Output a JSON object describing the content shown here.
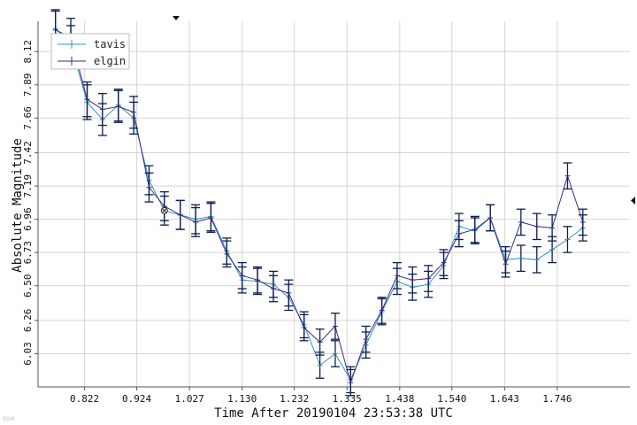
{
  "chart_data": {
    "type": "line",
    "xlabel": "Time After 20190104 23:53:38 UTC",
    "ylabel": "Absolute Magnitude",
    "x_ticks": [
      0.822,
      0.924,
      1.027,
      1.13,
      1.232,
      1.335,
      1.438,
      1.54,
      1.643,
      1.746
    ],
    "x_tick_labels": [
      "0.822",
      "0.924",
      "1.027",
      "1.130",
      "1.232",
      "1.335",
      "1.438",
      "1.540",
      "1.643",
      "1.746"
    ],
    "y_ticks": [
      6.03,
      6.26,
      6.5,
      6.73,
      6.96,
      7.19,
      7.42,
      7.66,
      7.89,
      8.12
    ],
    "y_tick_labels": [
      "6.03",
      "6.26",
      "6.50",
      "6.73",
      "6.96",
      "7.19",
      "7.42",
      "7.66",
      "7.89",
      "8.12"
    ],
    "xlim": [
      0.731,
      1.888
    ],
    "ylim": [
      8.33,
      5.8
    ],
    "y_inverted": true,
    "grid": true,
    "legend_position": "top-left",
    "series": [
      {
        "name": "tavis",
        "color": "#2f97b4",
        "x": [
          0.765,
          0.795,
          0.827,
          0.857,
          0.888,
          0.918,
          0.948,
          0.978,
          1.009,
          1.039,
          1.069,
          1.1,
          1.13,
          1.16,
          1.191,
          1.221,
          1.251,
          1.282,
          1.312,
          1.342,
          1.372,
          1.403,
          1.433,
          1.463,
          1.494,
          1.524,
          1.554,
          1.585,
          1.615,
          1.645,
          1.675,
          1.706,
          1.736,
          1.766,
          1.796
        ],
        "y": [
          8.28,
          8.17,
          7.77,
          7.65,
          7.75,
          7.66,
          7.23,
          7.02,
          6.99,
          6.96,
          6.98,
          6.74,
          6.54,
          6.53,
          6.51,
          6.42,
          6.23,
          5.95,
          6.03,
          5.85,
          6.09,
          6.32,
          6.53,
          6.49,
          6.51,
          6.64,
          6.91,
          6.88,
          6.97,
          6.68,
          6.69,
          6.68,
          6.75,
          6.82,
          6.9
        ],
        "err": [
          0.13,
          0.13,
          0.12,
          0.11,
          0.11,
          0.11,
          0.1,
          0.1,
          0.1,
          0.1,
          0.1,
          0.09,
          0.09,
          0.09,
          0.09,
          0.09,
          0.09,
          0.09,
          0.09,
          0.09,
          0.09,
          0.09,
          0.09,
          0.09,
          0.09,
          0.09,
          0.09,
          0.09,
          0.09,
          0.09,
          0.09,
          0.09,
          0.09,
          0.09,
          0.09
        ]
      },
      {
        "name": "elgin",
        "color": "#3a2a8e",
        "x": [
          0.765,
          0.795,
          0.827,
          0.857,
          0.888,
          0.918,
          0.948,
          0.978,
          1.009,
          1.039,
          1.069,
          1.1,
          1.13,
          1.16,
          1.191,
          1.221,
          1.251,
          1.282,
          1.312,
          1.342,
          1.372,
          1.403,
          1.433,
          1.463,
          1.494,
          1.524,
          1.554,
          1.585,
          1.615,
          1.645,
          1.675,
          1.706,
          1.736,
          1.766,
          1.796
        ],
        "y": [
          8.27,
          8.22,
          7.79,
          7.72,
          7.74,
          7.7,
          7.18,
          7.05,
          6.99,
          6.94,
          6.97,
          6.72,
          6.57,
          6.54,
          6.48,
          6.45,
          6.21,
          6.11,
          6.22,
          5.83,
          6.13,
          6.33,
          6.57,
          6.54,
          6.55,
          6.66,
          6.86,
          6.89,
          6.97,
          6.65,
          6.94,
          6.91,
          6.9,
          7.26,
          6.94
        ],
        "err": [
          0.13,
          0.13,
          0.12,
          0.11,
          0.11,
          0.11,
          0.1,
          0.1,
          0.1,
          0.1,
          0.1,
          0.09,
          0.09,
          0.09,
          0.09,
          0.09,
          0.09,
          0.09,
          0.09,
          0.09,
          0.09,
          0.09,
          0.09,
          0.09,
          0.09,
          0.09,
          0.09,
          0.09,
          0.09,
          0.09,
          0.09,
          0.09,
          0.09,
          0.09,
          0.09
        ]
      }
    ],
    "reference_marker": {
      "x": 0.978,
      "y": 7.02
    }
  },
  "colors": {
    "grid": "#d4d4d4",
    "axis": "#555555",
    "errorbar": "#0c1f4f"
  },
  "corner_note": "EGM"
}
